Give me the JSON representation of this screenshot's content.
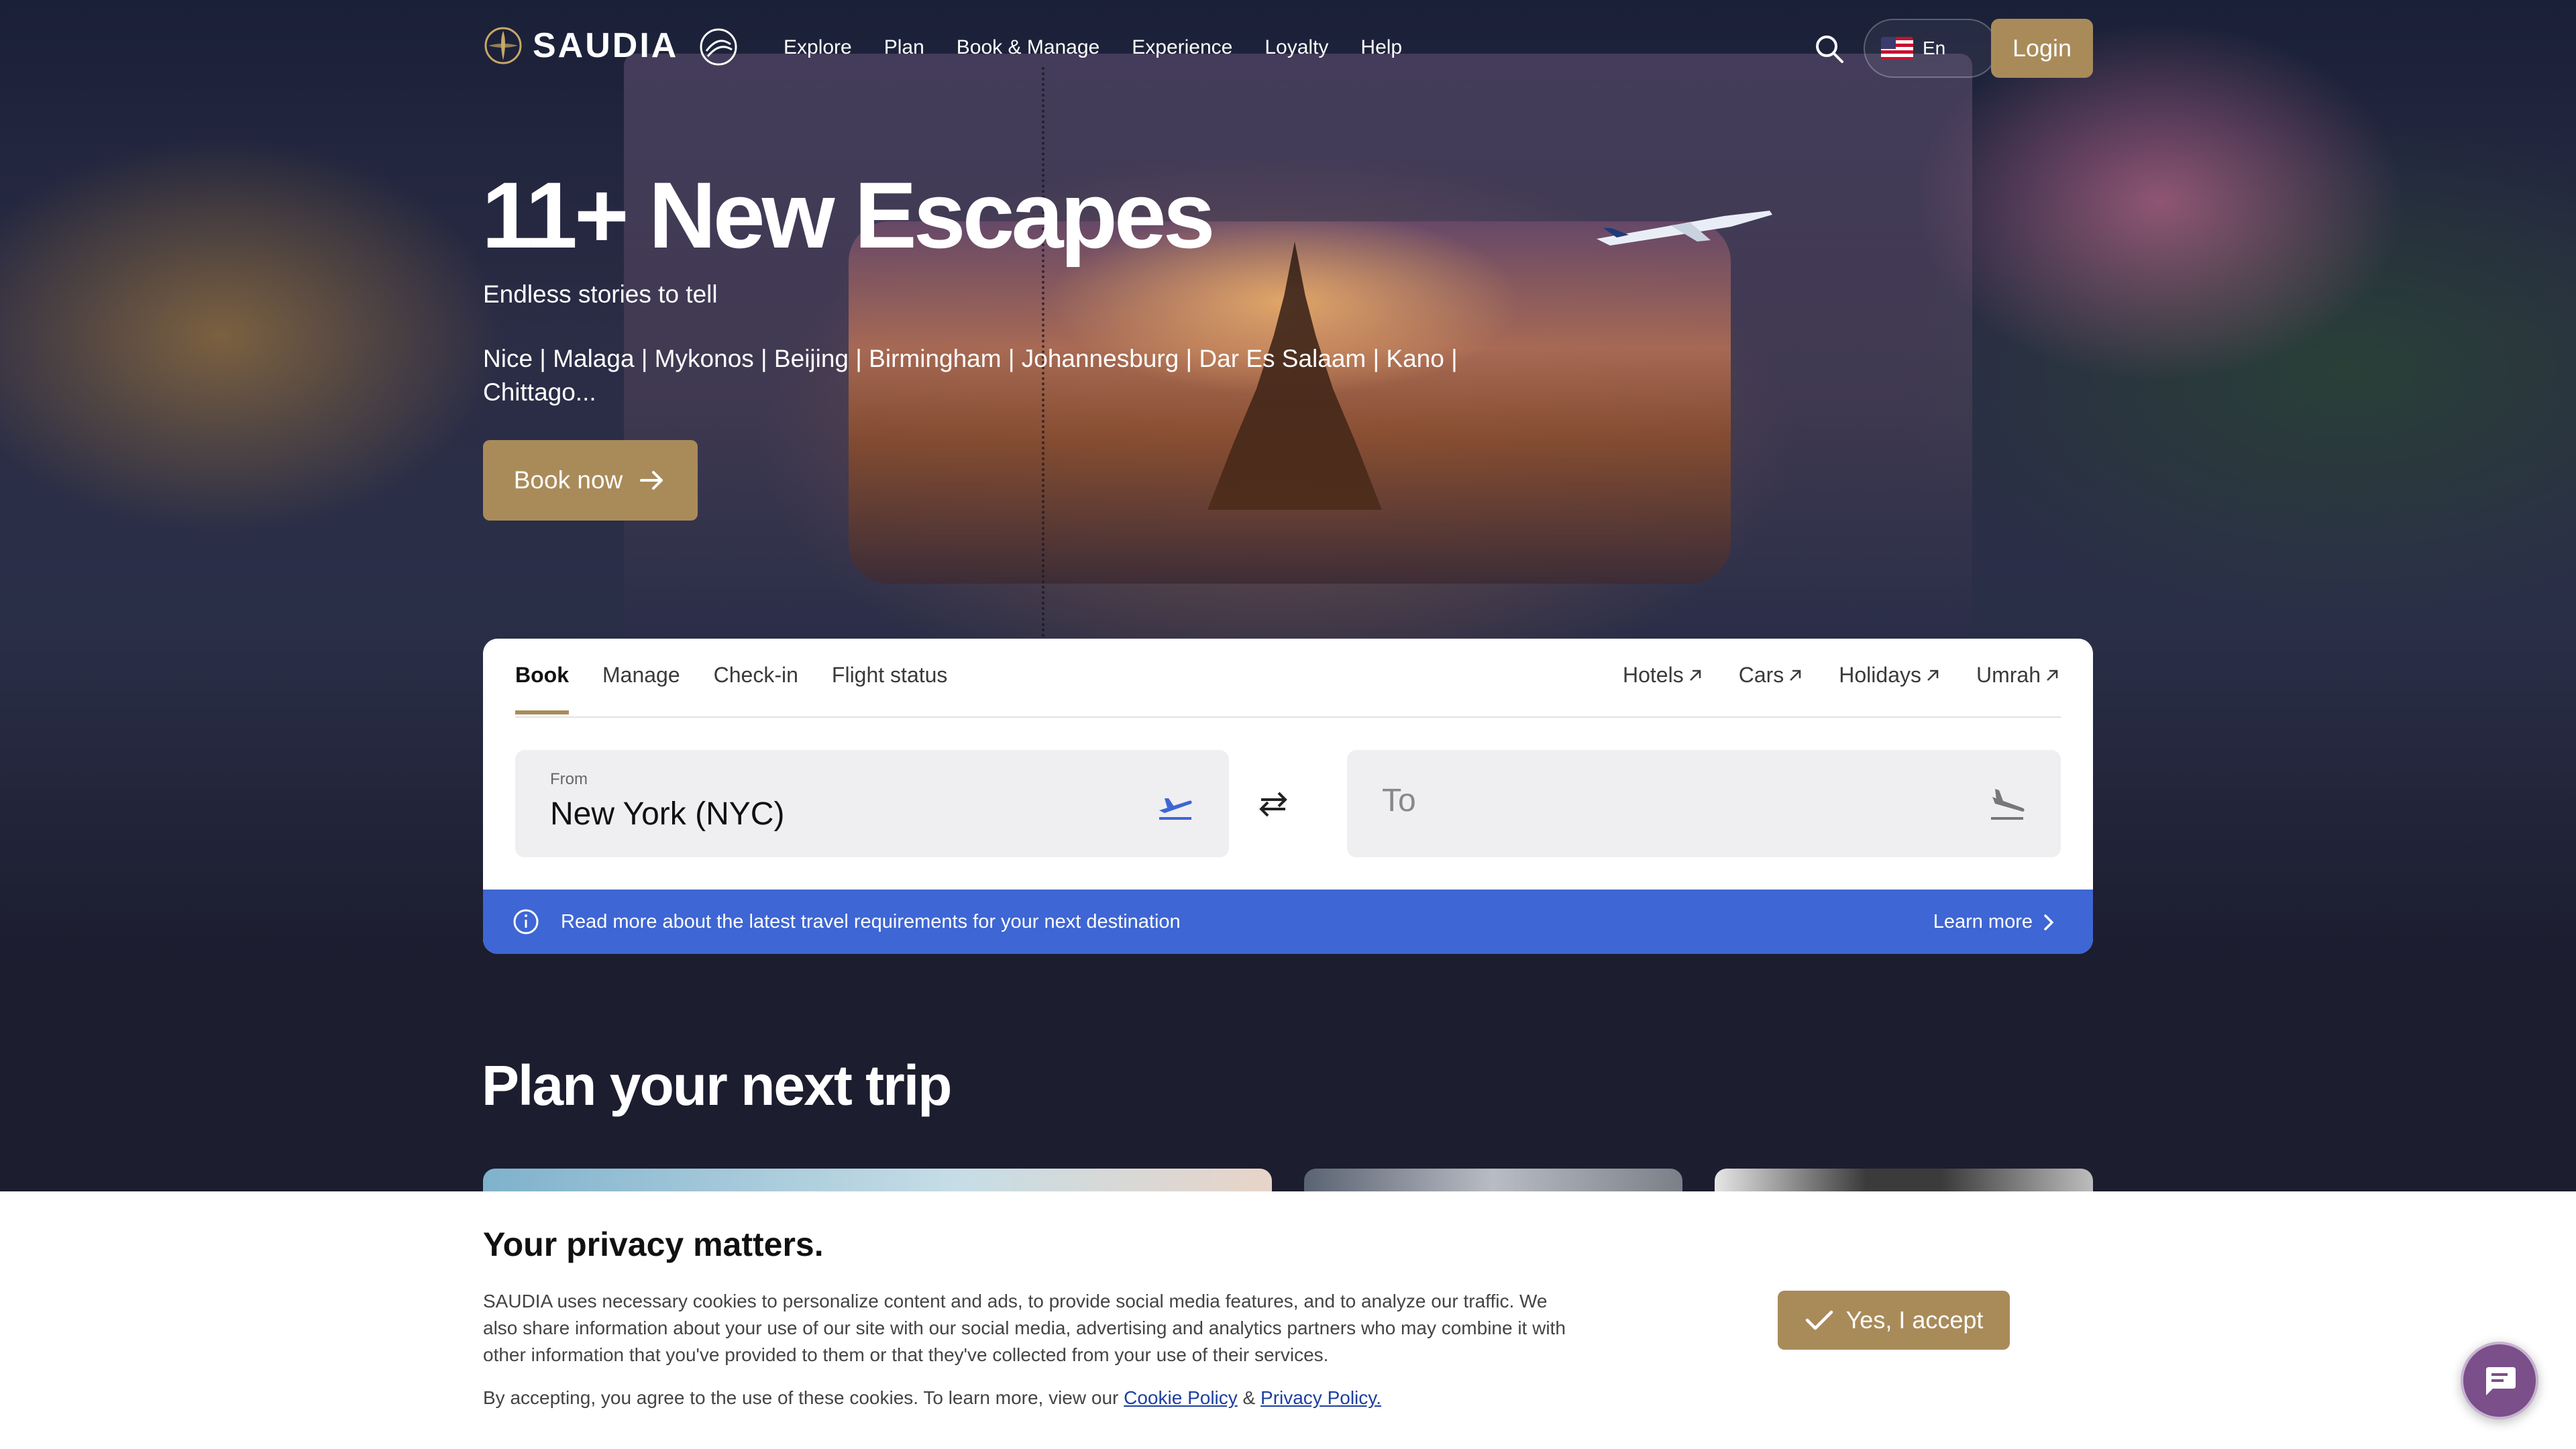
{
  "header": {
    "logo_text": "SAUDIA",
    "nav": [
      "Explore",
      "Plan",
      "Book & Manage",
      "Experience",
      "Loyalty",
      "Help"
    ],
    "language": "En",
    "login_label": "Login"
  },
  "hero": {
    "title": "11+ New Escapes",
    "subtitle": "Endless stories to tell",
    "destinations": "Nice | Malaga | Mykonos | Beijing | Birmingham | Johannesburg | Dar Es Salaam | Kano | Chittago...",
    "cta_label": "Book now"
  },
  "booking": {
    "tabs": [
      "Book",
      "Manage",
      "Check-in",
      "Flight status"
    ],
    "external_tabs": [
      "Hotels",
      "Cars",
      "Holidays",
      "Umrah"
    ],
    "from_label": "From",
    "from_value": "New York (NYC)",
    "to_placeholder": "To",
    "info_text": "Read more about the latest travel requirements for your next destination",
    "learn_more_label": "Learn more"
  },
  "plan": {
    "title": "Plan your next trip"
  },
  "cookie": {
    "title": "Your privacy matters.",
    "body": "SAUDIA uses necessary cookies to personalize content and ads, to provide social media features, and to analyze our traffic. We also share information about your use of our site with our social media, advertising and analytics partners who may combine it with other information that you've provided to them or that they've collected from your use of their services.",
    "consent_prefix": "By accepting, you agree to the use of these cookies. To learn more, view our ",
    "cookie_policy_label": "Cookie Policy",
    "amp": " & ",
    "privacy_policy_label": "Privacy Policy.",
    "accept_label": "Yes, I accept"
  },
  "colors": {
    "gold": "#a98b5a",
    "info_blue": "#3e66d4",
    "chat_purple": "#7b4f89",
    "page_navy": "#1c1d2f"
  }
}
